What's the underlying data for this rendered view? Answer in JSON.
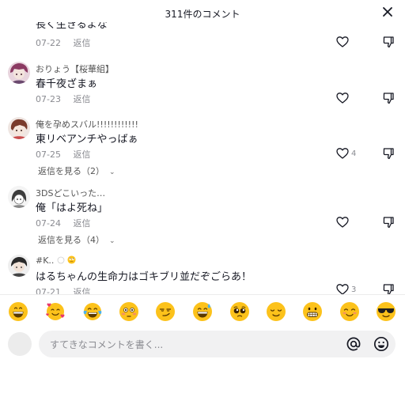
{
  "header": {
    "title": "311件のコメント",
    "close_icon": "close-icon"
  },
  "comments": [
    {
      "username": "",
      "text": "長く生きるよな",
      "date": "07-22",
      "reply_label": "返信",
      "likes": ""
    },
    {
      "username": "おりょう【桜華組】",
      "text": "春千夜ざまぁ",
      "date": "07-23",
      "reply_label": "返信",
      "likes": ""
    },
    {
      "username": "俺を孕めスバル!!!!!!!!!!!!",
      "text": "東リベアンチやっばぁ",
      "date": "07-25",
      "reply_label": "返信",
      "likes": "4",
      "view_replies": "返信を見る（2）"
    },
    {
      "username": "3DSどこいった…",
      "text": "俺「はよ死ね」",
      "date": "07-24",
      "reply_label": "返信",
      "likes": "",
      "view_replies": "返信を見る（4）"
    },
    {
      "username": "#K..",
      "text": "はるちゃんの生命力はゴキブリ並だぞごらあ！",
      "date": "07-21",
      "reply_label": "返信",
      "likes": "3"
    }
  ],
  "emoji_bar": [
    "grinning-face",
    "smiling-face-with-hearts",
    "face-with-tears-of-joy",
    "flushed-face",
    "smirking-face",
    "grinning-face-with-sweat",
    "pleading-face",
    "relieved-face",
    "grimacing-face",
    "smiling-face",
    "smiling-face-with-sunglasses"
  ],
  "input": {
    "placeholder": "すてきなコメントを書く..."
  },
  "colors": {
    "text": "#161823",
    "muted": "#8a8b91",
    "input_bg": "#f1f1f2",
    "emoji_yellow": "#fcc21b"
  }
}
